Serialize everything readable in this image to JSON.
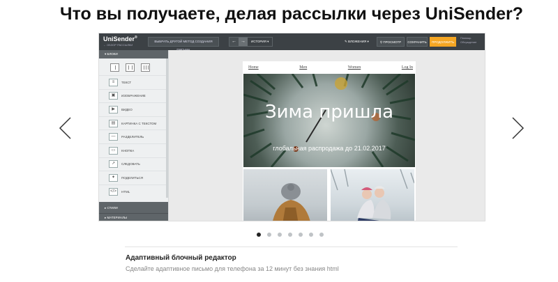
{
  "page": {
    "heading": "Что вы получаете, делая рассылки через UniSender?"
  },
  "editor": {
    "logo": "UniSender",
    "logo_sub": "← ОБЗОР РАССЫЛКИ",
    "method_button": "ВЫБРАТЬ ДРУГОЙ МЕТОД СОЗДАНИЯ ПИСЬМА",
    "history_label": "ИСТОРИЯ",
    "attachments_label": "ВЛОЖЕНИЯ",
    "preview_label": "ПРОСМОТР",
    "save_label": "СОХРАНИТЬ",
    "continue_label": "ПРОДОЛЖИТЬ",
    "help_line1": "Помощь",
    "help_line2": "Обсуждение"
  },
  "sidebar": {
    "blocks_header": "БЛОКИ",
    "items": [
      {
        "icon": "text-icon",
        "glyph": "≡",
        "label": "ТЕКСТ"
      },
      {
        "icon": "image-icon",
        "glyph": "▣",
        "label": "ИЗОБРАЖЕНИЕ"
      },
      {
        "icon": "video-icon",
        "glyph": "▶",
        "label": "ВИДЕО"
      },
      {
        "icon": "image-text-icon",
        "glyph": "▤",
        "label": "КАРТИНКА С ТЕКСТОМ"
      },
      {
        "icon": "divider-icon",
        "glyph": "—",
        "label": "РАЗДЕЛИТЕЛЬ"
      },
      {
        "icon": "button-icon",
        "glyph": "▭",
        "label": "КНОПКА"
      },
      {
        "icon": "follow-icon",
        "glyph": "↗",
        "label": "СЛЕДОВАТЬ"
      },
      {
        "icon": "twitter-icon",
        "glyph": "✦",
        "label": "ПОДЕЛИТЬСЯ"
      },
      {
        "icon": "html-icon",
        "glyph": "</>",
        "label": "HTML"
      }
    ],
    "styles_header": "СТИЛИ",
    "materials_header": "МАТЕРИАЛЫ"
  },
  "email": {
    "nav": [
      "Home",
      "Men",
      "Women",
      "Log In"
    ],
    "hero_title": "Зима пришла",
    "hero_subtitle": "глобальная распродажа до 21.02.2017"
  },
  "carousel": {
    "slide_count": 7,
    "active_index": 0
  },
  "caption": {
    "title": "Адаптивный блочный редактор",
    "text": "Сделайте адаптивное письмо для телефона за 12 минут без знания html"
  },
  "colors": {
    "accent": "#f5a623",
    "toolbar": "#3c4145",
    "active_dot": "#222222"
  }
}
